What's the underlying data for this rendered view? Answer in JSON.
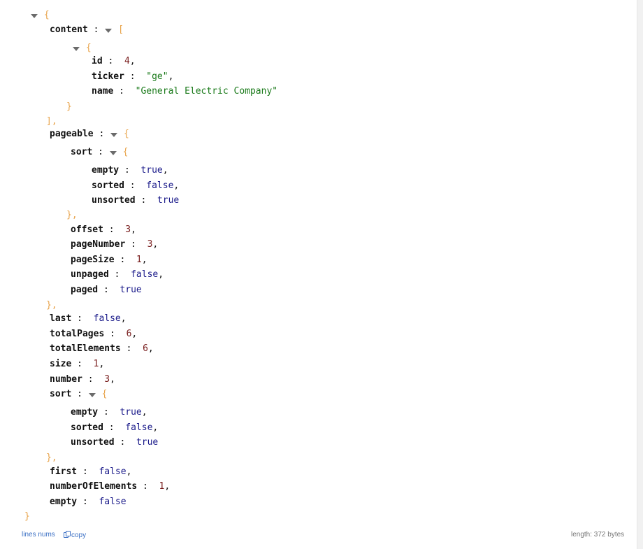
{
  "json_view": {
    "root_open": "{",
    "root_close": "}",
    "content": {
      "key": "content",
      "open": "[",
      "close": "],",
      "item": {
        "open": "{",
        "close": "}",
        "id_key": "id",
        "id_val": "4",
        "id_comma": ",",
        "ticker_key": "ticker",
        "ticker_val": "\"ge\"",
        "ticker_comma": ",",
        "name_key": "name",
        "name_val": "\"General Electric Company\""
      }
    },
    "pageable": {
      "key": "pageable",
      "open": "{",
      "close": "},",
      "sort": {
        "key": "sort",
        "open": "{",
        "close": "},",
        "empty_key": "empty",
        "empty_val": "true",
        "empty_comma": ",",
        "sorted_key": "sorted",
        "sorted_val": "false",
        "sorted_comma": ",",
        "unsorted_key": "unsorted",
        "unsorted_val": "true"
      },
      "offset_key": "offset",
      "offset_val": "3",
      "offset_comma": ",",
      "pageNumber_key": "pageNumber",
      "pageNumber_val": "3",
      "pageNumber_comma": ",",
      "pageSize_key": "pageSize",
      "pageSize_val": "1",
      "pageSize_comma": ",",
      "unpaged_key": "unpaged",
      "unpaged_val": "false",
      "unpaged_comma": ",",
      "paged_key": "paged",
      "paged_val": "true"
    },
    "last_key": "last",
    "last_val": "false",
    "last_comma": ",",
    "totalPages_key": "totalPages",
    "totalPages_val": "6",
    "totalPages_comma": ",",
    "totalElements_key": "totalElements",
    "totalElements_val": "6",
    "totalElements_comma": ",",
    "size_key": "size",
    "size_val": "1",
    "size_comma": ",",
    "number_key": "number",
    "number_val": "3",
    "number_comma": ",",
    "sort": {
      "key": "sort",
      "open": "{",
      "close": "},",
      "empty_key": "empty",
      "empty_val": "true",
      "empty_comma": ",",
      "sorted_key": "sorted",
      "sorted_val": "false",
      "sorted_comma": ",",
      "unsorted_key": "unsorted",
      "unsorted_val": "true"
    },
    "first_key": "first",
    "first_val": "false",
    "first_comma": ",",
    "numberOfElements_key": "numberOfElements",
    "numberOfElements_val": "1",
    "numberOfElements_comma": ",",
    "empty_key": "empty",
    "empty_val": "false"
  },
  "footer": {
    "lines_nums": "lines nums",
    "copy": "copy",
    "length": "length: 372 bytes"
  },
  "icons": {
    "toggle": "caret-down-icon",
    "copy": "copy-icon"
  }
}
